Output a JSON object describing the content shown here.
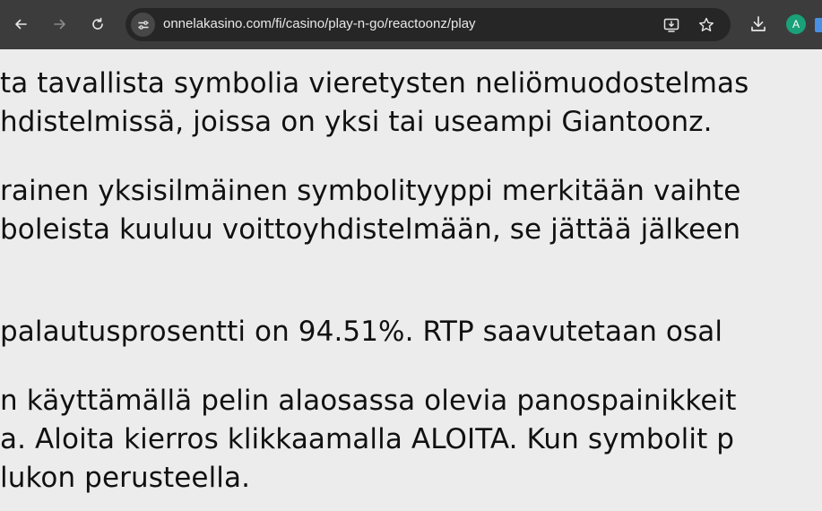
{
  "browser": {
    "url": "onnelakasino.com/fi/casino/play-n-go/reactoonz/play",
    "profile_initial": "A",
    "icons": {
      "back": "arrow-left-icon",
      "forward": "arrow-right-icon",
      "reload": "reload-icon",
      "site_info": "tune-icon",
      "install": "install-app-icon",
      "bookmark": "star-icon",
      "download": "download-icon"
    },
    "colors": {
      "toolbar": "#3c3c3c",
      "omnibox": "#262626",
      "avatar": "#1aa179"
    }
  },
  "page": {
    "lines": [
      "ta tavallista symbolia vieretysten neliömuodostelmas",
      "hdistelmissä, joissa on yksi tai useampi Giantoonz.",
      "rainen yksisilmäinen symbolityyppi merkitään vaihte",
      "boleista kuuluu voittoyhdistelmään, se jättää jälkeen",
      "palautusprosentti on 94.51%. RTP saavutetaan osal",
      "n käyttämällä pelin alaosassa olevia panospainikkeit",
      "a. Aloita kierros klikkaamalla ALOITA. Kun symbolit p",
      "lukon perusteella."
    ]
  }
}
